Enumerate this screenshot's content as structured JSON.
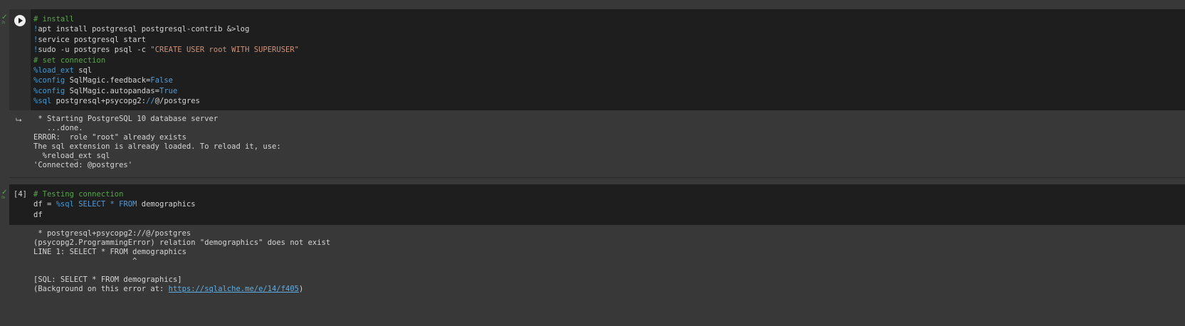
{
  "cell1": {
    "status": "✓",
    "status_time": "2s",
    "code": [
      [
        {
          "t": "# install",
          "c": "c-comment"
        }
      ],
      [
        {
          "t": "!",
          "c": "c-bang"
        },
        {
          "t": "apt install postgresql postgresql-contrib &>log",
          "c": "c-plain"
        }
      ],
      [
        {
          "t": "!",
          "c": "c-bang"
        },
        {
          "t": "service postgresql start",
          "c": "c-plain"
        }
      ],
      [
        {
          "t": "!",
          "c": "c-bang"
        },
        {
          "t": "sudo -u postgres psql -c ",
          "c": "c-plain"
        },
        {
          "t": "\"CREATE USER root WITH SUPERUSER\"",
          "c": "c-str"
        }
      ],
      [
        {
          "t": "# set connection",
          "c": "c-comment"
        }
      ],
      [
        {
          "t": "%load_ext",
          "c": "c-magic"
        },
        {
          "t": " sql",
          "c": "c-plain"
        }
      ],
      [
        {
          "t": "%config",
          "c": "c-magic"
        },
        {
          "t": " SqlMagic.feedback=",
          "c": "c-plain"
        },
        {
          "t": "False",
          "c": "c-kw"
        }
      ],
      [
        {
          "t": "%config",
          "c": "c-magic"
        },
        {
          "t": " SqlMagic.autopandas=",
          "c": "c-plain"
        },
        {
          "t": "True",
          "c": "c-kw"
        }
      ],
      [
        {
          "t": "%sql",
          "c": "c-magic"
        },
        {
          "t": " postgresql+psycopg2:",
          "c": "c-plain"
        },
        {
          "t": "//",
          "c": "c-kw"
        },
        {
          "t": "@/postgres",
          "c": "c-plain"
        }
      ]
    ],
    "output": [
      " * Starting PostgreSQL 10 database server",
      "   ...done.",
      "ERROR:  role \"root\" already exists",
      "The sql extension is already loaded. To reload it, use:",
      "  %reload_ext sql",
      "'Connected: @postgres'"
    ]
  },
  "cell2": {
    "status": "✓",
    "status_time": "0s",
    "exec_count": "[4]",
    "code": [
      [
        {
          "t": "# Testing connection",
          "c": "c-comment"
        }
      ],
      [
        {
          "t": "df = ",
          "c": "c-plain"
        },
        {
          "t": "%sql",
          "c": "c-magic"
        },
        {
          "t": " SELECT * FROM",
          "c": "c-kw"
        },
        {
          "t": " demographics",
          "c": "c-plain"
        }
      ],
      [
        {
          "t": "df",
          "c": "c-plain"
        }
      ]
    ],
    "output": [
      " * postgresql+psycopg2://@/postgres",
      "(psycopg2.ProgrammingError) relation \"demographics\" does not exist",
      "LINE 1: SELECT * FROM demographics",
      "                      ^",
      "",
      "[SQL: SELECT * FROM demographics]"
    ],
    "output_last_prefix": "(Background on this error at: ",
    "output_link": "https://sqlalche.me/e/14/f405",
    "output_last_suffix": ")"
  }
}
